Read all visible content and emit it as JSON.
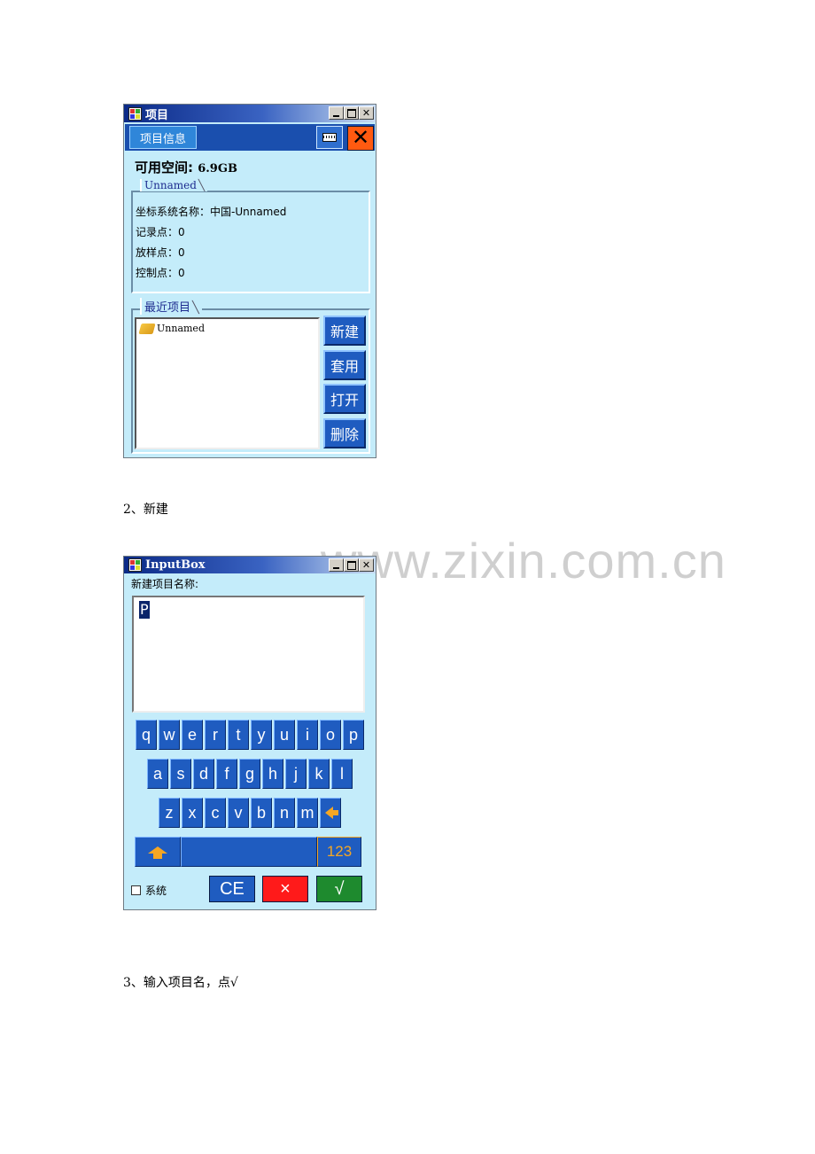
{
  "project_window": {
    "title": "项目",
    "tab_label": "项目信息",
    "close_glyph": "✕",
    "free_space_label": "可用空间:",
    "free_space_value": "6.9GB",
    "project_group_title": "Unnamed",
    "info": {
      "coord_system": "坐标系统名称：中国-Unnamed",
      "record_points": "记录点：0",
      "stakeout_points": "放样点：0",
      "control_points": "控制点：0"
    },
    "recent_group_title": "最近项目",
    "recent_items": [
      "Unnamed"
    ],
    "buttons": {
      "new": "新建",
      "apply": "套用",
      "open": "打开",
      "delete": "删除"
    }
  },
  "captions": {
    "step2": "2、新建",
    "step3": "3、输入项目名，点√"
  },
  "watermark": "www.zixin.com.cn",
  "input_window": {
    "title": "InputBox",
    "prompt": "新建项目名称:",
    "value": "P",
    "keyboard": {
      "row1": [
        "q",
        "w",
        "e",
        "r",
        "t",
        "y",
        "u",
        "i",
        "o",
        "p"
      ],
      "row2": [
        "a",
        "s",
        "d",
        "f",
        "g",
        "h",
        "j",
        "k",
        "l"
      ],
      "row3": [
        "z",
        "x",
        "c",
        "v",
        "b",
        "n",
        "m"
      ],
      "mode_key": "123"
    },
    "system_checkbox_label": "系统",
    "actions": {
      "clear": "CE",
      "cancel": "×",
      "ok": "√"
    },
    "colors": {
      "ok": "#1e8a2e",
      "cancel": "#ff1a1a",
      "clear": "#1f5cc0"
    }
  }
}
